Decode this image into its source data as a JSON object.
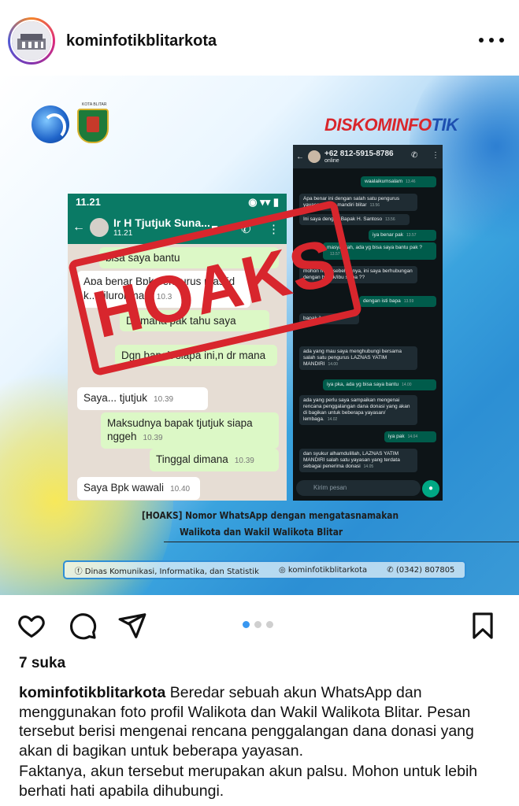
{
  "header": {
    "username": "kominfotikblitarkota"
  },
  "post_image": {
    "brand_part1": "DISKOMINFO",
    "brand_part2": "TIK",
    "logo2_caption": "KOTA BLITAR",
    "stamp_text": "HOAKS",
    "caption_line1": "[HOAKS] Nomor WhatsApp dengan mengatasnamakan",
    "caption_line2": "Walikota dan Wakil Walikota Blitar",
    "footer_dept": "Dinas Komunikasi, Informatika, dan Statistik",
    "footer_ig": "kominfotikblitarkota",
    "footer_phone": "(0342) 807805",
    "chat1": {
      "status_time": "11.21",
      "contact_name": "Ir H Tjutjuk Suna...",
      "contact_status": "11.21",
      "messages": [
        {
          "text": "bisa saya bantu",
          "time": "",
          "dir": "out"
        },
        {
          "text": "Apa benar Bpk pengurus masjid",
          "time": "",
          "dir": "in"
        },
        {
          "text": "k...oilurohman",
          "time": "10.3",
          "dir": "in"
        },
        {
          "text": "Dr mana pak tahu saya",
          "time": "",
          "dir": "out"
        },
        {
          "text": "Dgn bapak siapa ini,n dr mana",
          "time": "",
          "dir": "out"
        },
        {
          "text": "Saya... tjutjuk",
          "time": "10.39",
          "dir": "in"
        },
        {
          "text": "Maksudnya bapak tjutjuk siapa nggeh",
          "time": "10.39",
          "dir": "out"
        },
        {
          "text": "Tinggal dimana",
          "time": "10.39",
          "dir": "out"
        },
        {
          "text": "Saya Bpk wawali",
          "time": "10.40",
          "dir": "in"
        }
      ]
    },
    "chat2": {
      "contact_name": "+62 812-5915-8786",
      "contact_status": "online",
      "input_placeholder": "Kirim pesan",
      "messages": [
        {
          "text": "waalaikumsalam",
          "time": "13.46",
          "dir": "out"
        },
        {
          "text": "Apa benar ini dengan salah satu pengurus yayasan yatim mandiri blitar",
          "time": "13.56",
          "dir": "in"
        },
        {
          "text": "Ini saya dengan Bapak H. Santoso",
          "time": "13.56",
          "dir": "in"
        },
        {
          "text": "iya benar pak",
          "time": "13.57",
          "dir": "out"
        },
        {
          "text": "masyaallah, ada yg bisa saya bantu pak ?",
          "time": "13.57",
          "dir": "out"
        },
        {
          "text": "mohon maaf sebelumnya, ini saya berhubungan dengan bapak/ibu siapa ??",
          "time": "",
          "dir": "in"
        },
        {
          "text": "dengan isti bapa",
          "time": "13.59",
          "dir": "out"
        },
        {
          "text": "bapak ibu",
          "time": "13.59",
          "dir": "in"
        },
        {
          "text": "ada yang mau saya menghubungi bersama salah satu pengurus LAZNAS YATIM MANDIRI",
          "time": "14.00",
          "dir": "in"
        },
        {
          "text": "iya pka, ada yg bisa saya bantu",
          "time": "14.00",
          "dir": "out"
        },
        {
          "text": "ada yang perlu saya sampaikan mengenai rencana penggalangan dana donasi yang akan di bagikan untuk beberapa yayasan/ lembaga.",
          "time": "14.02",
          "dir": "in"
        },
        {
          "text": "iya pak",
          "time": "14.04",
          "dir": "out"
        },
        {
          "text": "dan syukur alhamdulillah, LAZNAS YATIM MANDIRI salah satu yayasan yang terdata sebagai penerima donasi",
          "time": "14.05",
          "dir": "in"
        }
      ]
    }
  },
  "actions": {
    "carousel_dots": 3,
    "active_dot": 0
  },
  "likes": "7 suka",
  "caption": {
    "username": "kominfotikblitarkota",
    "paragraph1": " Beredar sebuah akun WhatsApp dan menggunakan foto profil Walikota dan  Wakil Walikota Blitar. Pesan tersebut berisi mengenai rencana penggalangan dana donasi yang akan di bagikan untuk beberapa yayasan.",
    "paragraph2": "Faktanya, akun tersebut merupakan akun palsu. Mohon untuk lebih berhati hati apabila dihubungi."
  },
  "colors": {
    "accent_blue": "#3897f0",
    "hoaks_red": "#d8262d",
    "whatsapp_green": "#0a7a65"
  }
}
